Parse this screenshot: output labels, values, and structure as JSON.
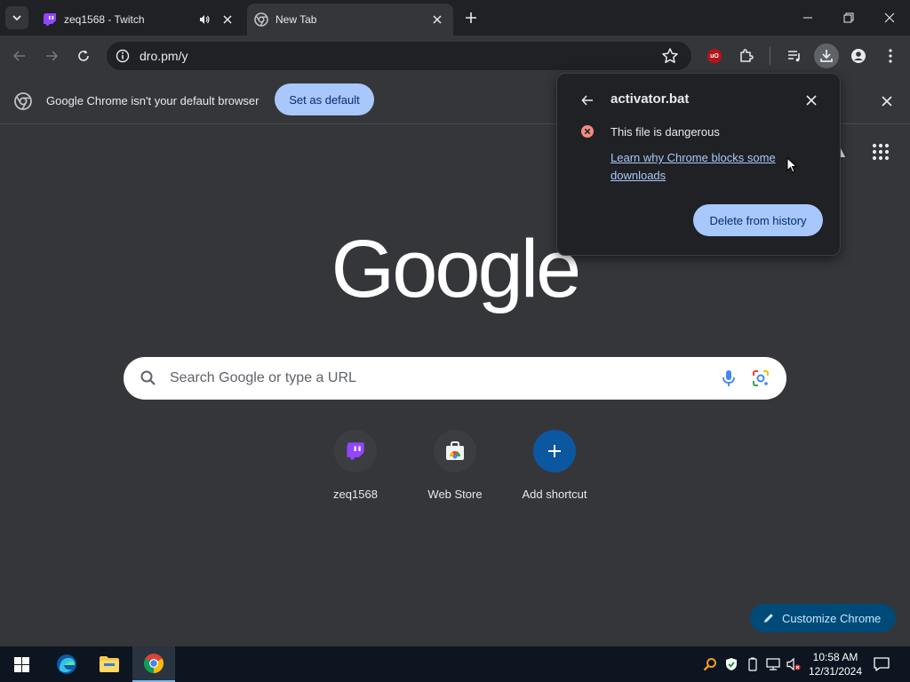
{
  "tabs": [
    {
      "title": "zeq1568 - Twitch",
      "favicon": "twitch-icon",
      "active": false,
      "audio": true
    },
    {
      "title": "New Tab",
      "favicon": "chrome-icon",
      "active": true,
      "audio": false
    }
  ],
  "toolbar": {
    "url": "dro.pm/y"
  },
  "infobar": {
    "message": "Google Chrome isn't your default browser",
    "button": "Set as default"
  },
  "download_bubble": {
    "filename": "activator.bat",
    "status": "This file is dangerous",
    "learn_link": "Learn why Chrome blocks some downloads",
    "action": "Delete from history"
  },
  "ntp": {
    "logo_text": "Google",
    "search_placeholder": "Search Google or type a URL",
    "shortcuts": [
      {
        "label": "zeq1568",
        "icon": "twitch-icon"
      },
      {
        "label": "Web Store",
        "icon": "web-store-icon"
      },
      {
        "label": "Add shortcut",
        "icon": "plus-icon"
      }
    ],
    "customize": "Customize Chrome"
  },
  "taskbar": {
    "time": "10:58 AM",
    "date": "12/31/2024"
  },
  "colors": {
    "accent": "#a8c7fa",
    "twitch": "#9146ff",
    "danger": "#f28b82",
    "customize_bg": "#004a77"
  }
}
